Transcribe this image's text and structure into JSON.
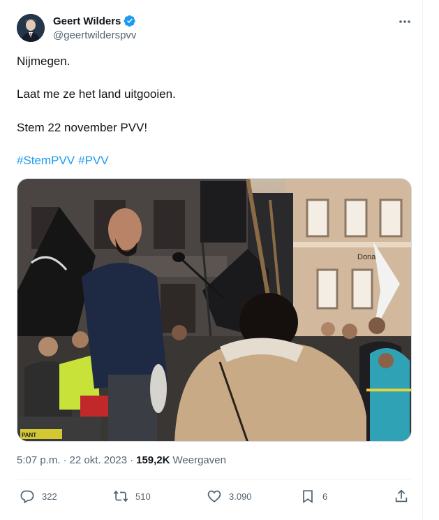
{
  "author": {
    "name": "Geert Wilders",
    "handle": "@geertwilderspvv",
    "verified": true
  },
  "tweet": {
    "lines": [
      "Nijmegen.",
      "Laat me ze het land uitgooien.",
      "Stem 22 november PVV!"
    ],
    "hashtags": [
      "#StemPVV",
      "#PVV"
    ]
  },
  "media_sign_text": "Donak",
  "media_banner_text": "PANT",
  "meta": {
    "time": "5:07 p.m.",
    "separator": "·",
    "date": "22 okt. 2023",
    "views_count": "159,2K",
    "views_label": "Weergaven"
  },
  "actions": {
    "replies": "322",
    "reposts": "510",
    "likes": "3.090",
    "bookmarks": "6"
  },
  "colors": {
    "link": "#1d9bf0",
    "secondary": "#536471",
    "verified": "#1d9bf0"
  },
  "icons": [
    "verified-badge-icon",
    "more-icon",
    "reply-icon",
    "repost-icon",
    "like-icon",
    "bookmark-icon",
    "share-icon"
  ]
}
